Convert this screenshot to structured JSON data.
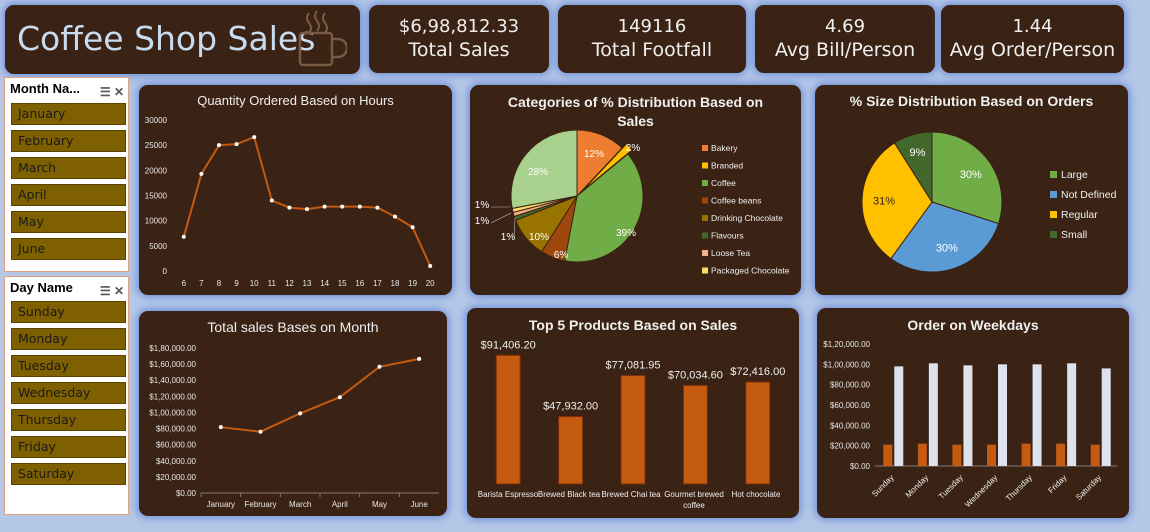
{
  "dashboard": {
    "title": "Coffee Shop Sales",
    "kpis": [
      {
        "value": "$6,98,812.33",
        "label": "Total Sales"
      },
      {
        "value": "149116",
        "label": "Total Footfall"
      },
      {
        "value": "4.69",
        "label": "Avg Bill/Person"
      },
      {
        "value": "1.44",
        "label": "Avg Order/Person"
      }
    ]
  },
  "slicers": {
    "month": {
      "header": "Month Na...",
      "items": [
        "January",
        "February",
        "March",
        "April",
        "May",
        "June"
      ]
    },
    "day": {
      "header": "Day Name",
      "items": [
        "Sunday",
        "Monday",
        "Tuesday",
        "Wednesday",
        "Thursday",
        "Friday",
        "Saturday"
      ]
    }
  },
  "colors": {
    "card": "#3a2214",
    "accent": "#c55a11",
    "background": "#b4c7e7"
  },
  "chart_data": [
    {
      "id": "hours",
      "type": "line",
      "title": "Quantity Ordered Based on Hours",
      "x": [
        6,
        7,
        8,
        9,
        10,
        11,
        12,
        13,
        14,
        15,
        16,
        17,
        18,
        19,
        20
      ],
      "values": [
        6800,
        19300,
        25000,
        25200,
        26600,
        14000,
        12600,
        12300,
        12800,
        12800,
        12800,
        12600,
        10800,
        8700,
        1000
      ],
      "yticks": [
        "30000",
        "25000",
        "20000",
        "15000",
        "10000",
        "5000",
        "0"
      ],
      "ylim": [
        0,
        30000
      ]
    },
    {
      "id": "categories",
      "type": "pie",
      "title": "Categories of % Distribution Based on Sales",
      "labels": [
        "Bakery",
        "Branded",
        "Coffee",
        "Coffee beans",
        "Drinking Chocolate",
        "Flavours",
        "Loose Tea",
        "Packaged Chocolate"
      ],
      "values": [
        12,
        2,
        39,
        6,
        10,
        1,
        1,
        1
      ],
      "extra_slice": 28,
      "slice_labels": [
        "12%",
        "2%",
        "39%",
        "6%",
        "10%",
        "1%",
        "1%",
        "1%",
        "28%"
      ],
      "colors": [
        "#ed7d31",
        "#ffc000",
        "#70ad47",
        "#9e480e",
        "#997300",
        "#43682b",
        "#f4b183",
        "#ffd966"
      ]
    },
    {
      "id": "sizes",
      "type": "pie",
      "title": "% Size Distribution Based on Orders",
      "labels": [
        "Large",
        "Not Defined",
        "Regular",
        "Small"
      ],
      "values": [
        30,
        30,
        31,
        9
      ],
      "slice_labels": [
        "30%",
        "30%",
        "31%",
        "9%"
      ],
      "colors": [
        "#70ad47",
        "#5b9bd5",
        "#ffc000",
        "#43682b"
      ]
    },
    {
      "id": "months",
      "type": "line",
      "title": "Total sales Bases on Month",
      "categories": [
        "January",
        "February",
        "March",
        "April",
        "May",
        "June"
      ],
      "values": [
        81700,
        76100,
        98800,
        118900,
        156700,
        166500
      ],
      "yticks": [
        "$1,80,000.00",
        "$1,60,000.00",
        "$1,40,000.00",
        "$1,20,000.00",
        "$1,00,000.00",
        "$80,000.00",
        "$60,000.00",
        "$40,000.00",
        "$20,000.00",
        "$0.00"
      ],
      "ylim": [
        0,
        180000
      ]
    },
    {
      "id": "products",
      "type": "bar",
      "title": "Top 5 Products Based on Sales",
      "categories": [
        "Barista Espresso",
        "Brewed Black tea",
        "Brewed Chai tea",
        "Gourmet brewed coffee",
        "Hot chocolate"
      ],
      "values": [
        91406.2,
        47932.0,
        77081.95,
        70034.6,
        72416.0
      ],
      "value_labels": [
        "$91,406.20",
        "$47,932.00",
        "$77,081.95",
        "$70,034.60",
        "$72,416.00"
      ],
      "ylim": [
        0,
        100000
      ]
    },
    {
      "id": "weekdays",
      "type": "bar",
      "title": "Order on Weekdays",
      "categories": [
        "Sunday",
        "Monday",
        "Tuesday",
        "Wednesday",
        "Thursday",
        "Friday",
        "Saturday"
      ],
      "series": [
        {
          "values": [
            21000,
            22000,
            21000,
            21000,
            22000,
            22000,
            21000
          ]
        },
        {
          "values": [
            98000,
            101000,
            99000,
            100000,
            100000,
            101000,
            96000
          ]
        }
      ],
      "yticks": [
        "$1,20,000.00",
        "$1,00,000.00",
        "$80,000.00",
        "$60,000.00",
        "$40,000.00",
        "$20,000.00",
        "$0.00"
      ],
      "ylim": [
        0,
        120000
      ]
    }
  ]
}
